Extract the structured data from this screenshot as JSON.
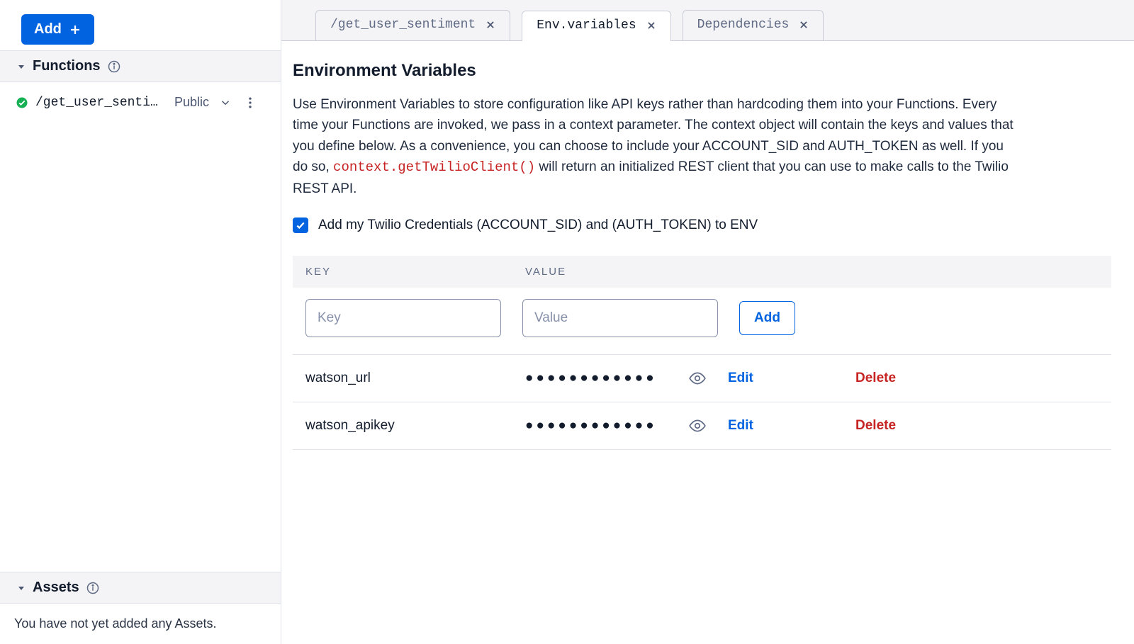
{
  "sidebar": {
    "add_label": "Add",
    "functions": {
      "title": "Functions",
      "items": [
        {
          "name": "/get_user_sentim…",
          "visibility": "Public"
        }
      ]
    },
    "assets": {
      "title": "Assets",
      "empty_text": "You have not yet added any Assets."
    }
  },
  "tabs": [
    {
      "label": "/get_user_sentiment",
      "active": false
    },
    {
      "label": "Env.variables",
      "active": true
    },
    {
      "label": "Dependencies",
      "active": false
    }
  ],
  "page": {
    "title": "Environment Variables",
    "desc_before_code": "Use Environment Variables to store configuration like API keys rather than hardcoding them into your Functions. Every time your Functions are invoked, we pass in a context parameter. The context object will contain the keys and values that you define below. As a convenience, you can choose to include your ACCOUNT_SID and AUTH_TOKEN as well. If you do so, ",
    "code": "context.getTwilioClient()",
    "desc_after_code": " will return an initialized REST client that you can use to make calls to the Twilio REST API.",
    "checkbox_label": "Add my Twilio Credentials (ACCOUNT_SID) and (AUTH_TOKEN) to ENV"
  },
  "table": {
    "header_key": "KEY",
    "header_value": "VALUE",
    "key_placeholder": "Key",
    "value_placeholder": "Value",
    "add_label": "Add",
    "edit_label": "Edit",
    "delete_label": "Delete",
    "masked_value": "●●●●●●●●●●●●",
    "rows": [
      {
        "key": "watson_url"
      },
      {
        "key": "watson_apikey"
      }
    ]
  }
}
